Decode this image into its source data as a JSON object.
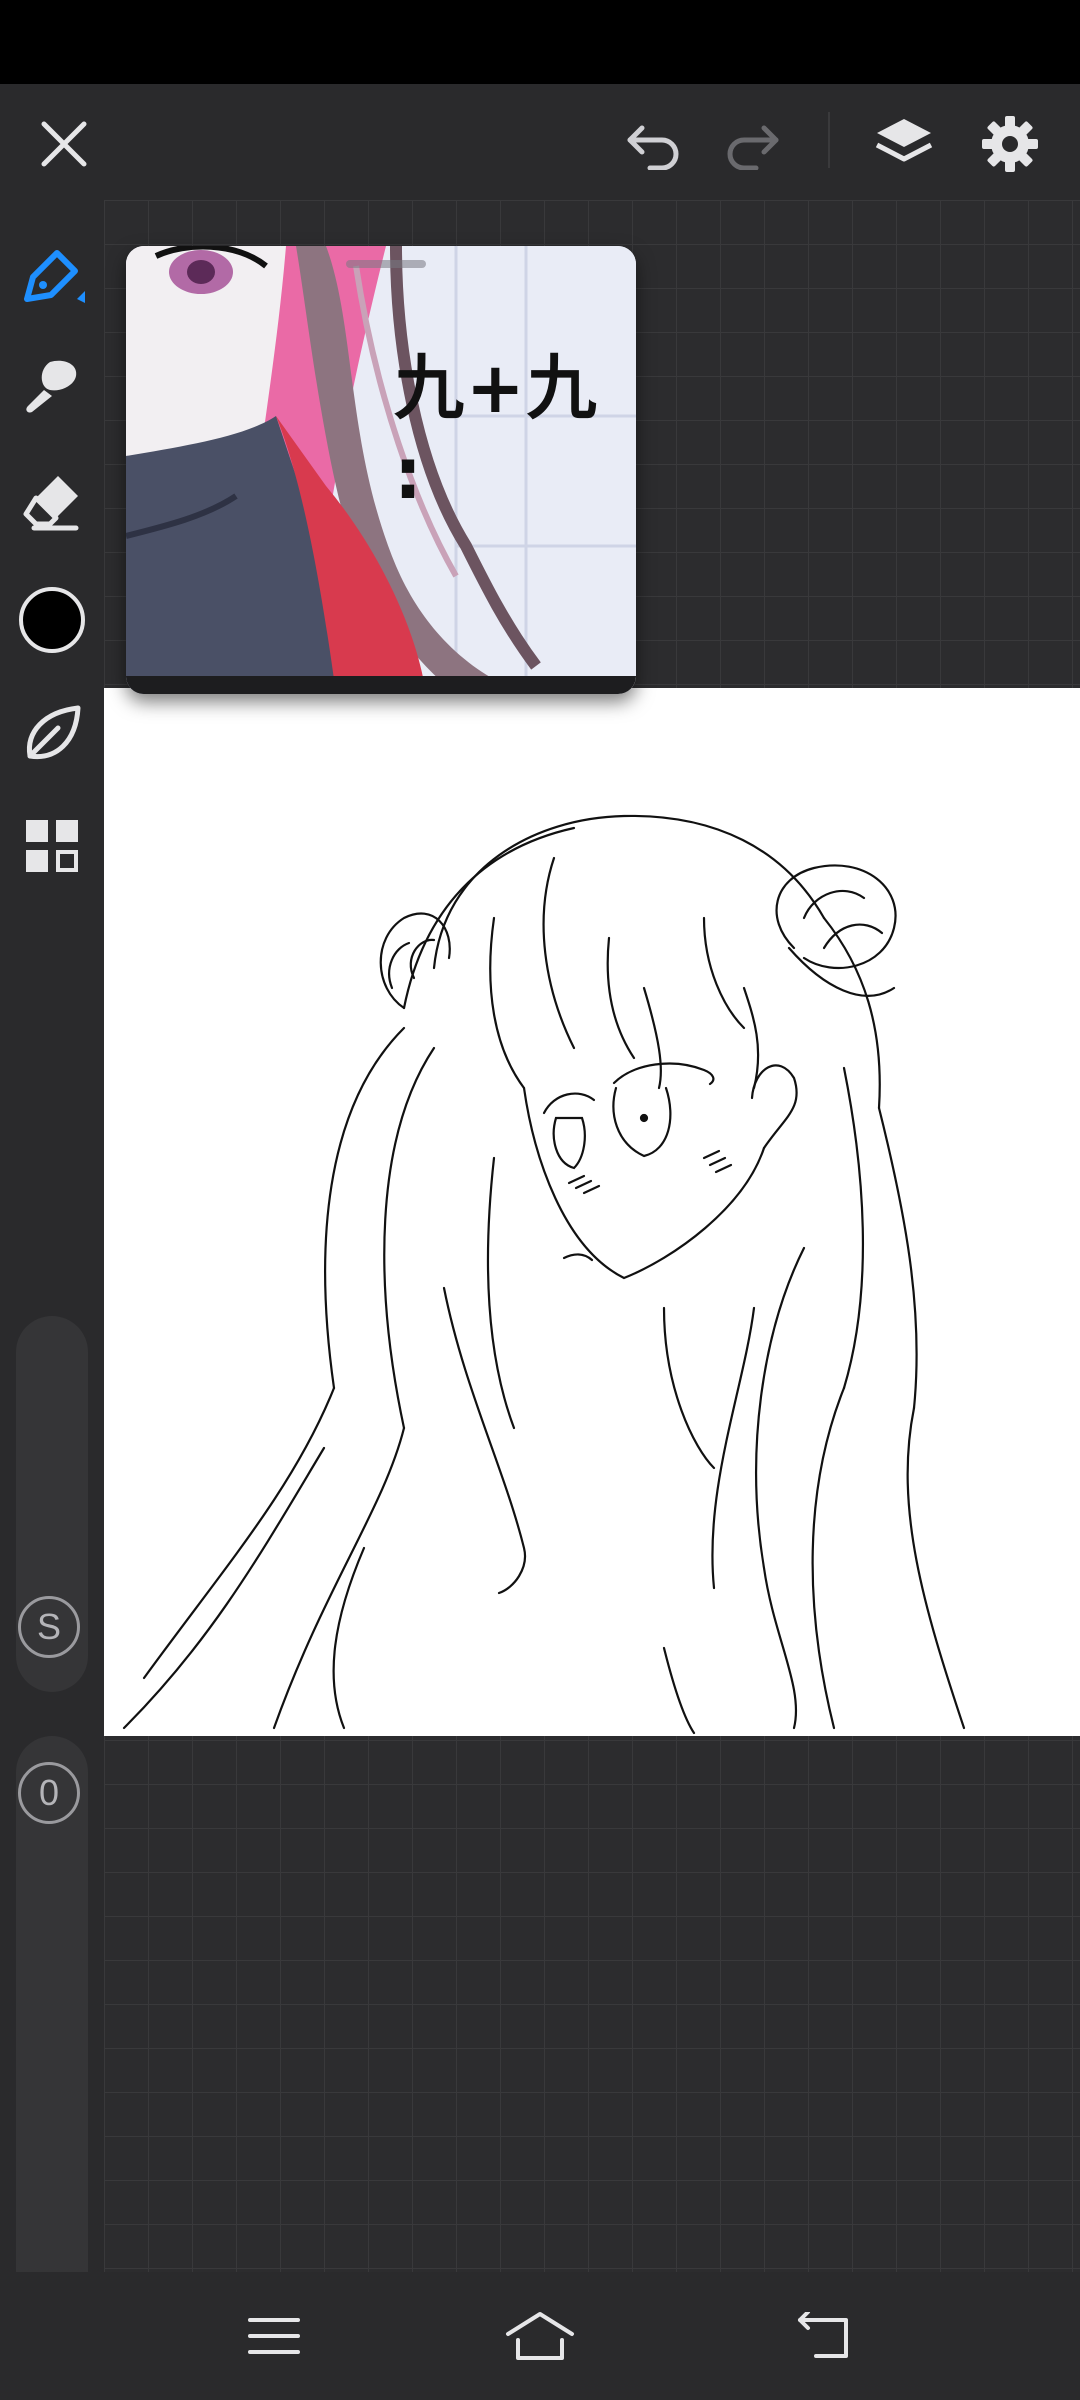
{
  "colors": {
    "background": "#1e1e20",
    "toolbar": "#2a2a2c",
    "canvas_grid": "#2c2c2e",
    "paper": "#ffffff",
    "accent": "#1e8fff",
    "brush_color": "#000000"
  },
  "topbar": {
    "icons": [
      "close-icon",
      "undo-icon",
      "redo-icon",
      "layers-icon",
      "settings-icon"
    ]
  },
  "sidebar": {
    "tools": [
      "pen-tool-icon",
      "brush-tool-icon",
      "eraser-tool-icon",
      "color-swatch",
      "leaf-brush-icon",
      "gallery-grid-icon"
    ],
    "active_tool": "pen-tool-icon",
    "size_slider": {
      "badge": "S"
    },
    "opacity_slider": {
      "badge": "0"
    }
  },
  "reference": {
    "text": "九+九 :"
  },
  "navbar": {
    "icons": [
      "menu-icon",
      "home-icon",
      "back-icon"
    ]
  }
}
